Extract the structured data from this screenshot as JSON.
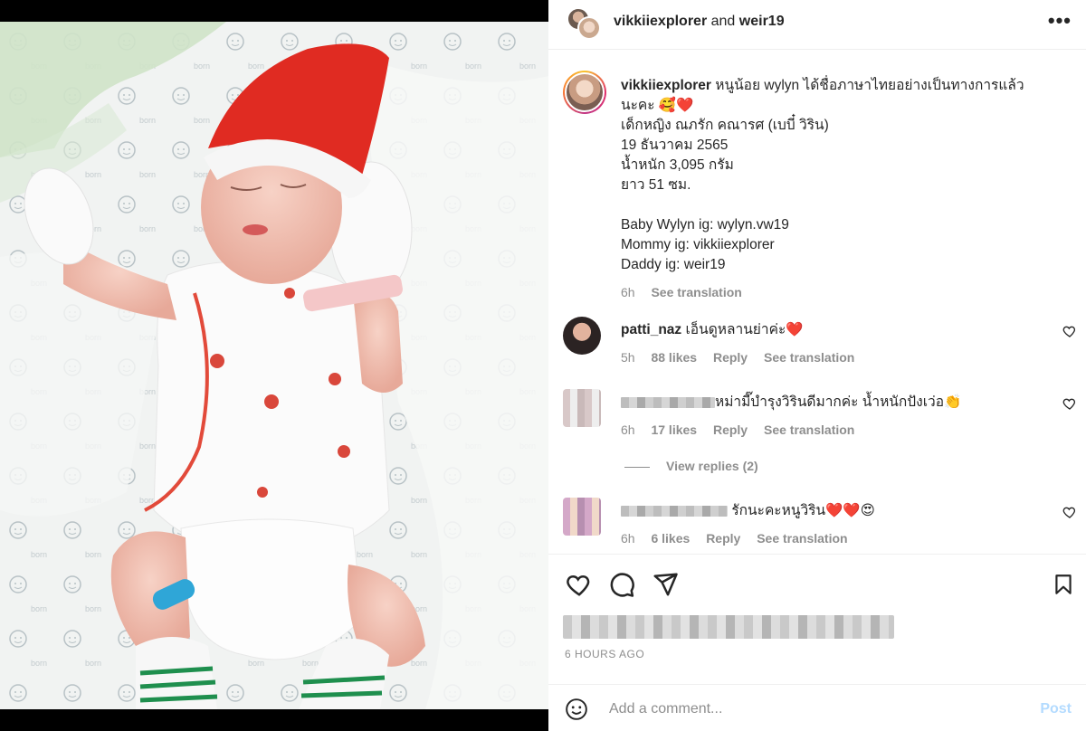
{
  "header": {
    "user1": "vikkiiexplorer",
    "and": "and",
    "user2": "weir19",
    "more": "•••"
  },
  "caption": {
    "username": "vikkiiexplorer",
    "line1": "หนูน้อย wylyn ได้ชื่อภาษาไทยอย่างเป็นทางการแล้ว",
    "line2": "นะคะ 🥰❤️",
    "line3": "เด็กหญิง ณภรัก คณารศ (เบบี๋ วิริน)",
    "line4": "19 ธันวาคม 2565",
    "line5": "น้ำหนัก 3,095 กรัม",
    "line6": "ยาว 51 ซม.",
    "line7": "Baby Wylyn ig: wylyn.vw19",
    "line8": "Mommy ig: vikkiiexplorer",
    "line9": "Daddy ig: weir19",
    "time": "6h",
    "translate": "See translation"
  },
  "comments": [
    {
      "username": "patti_naz",
      "text": "เอ็นดูหลานย่าค่ะ❤️",
      "time": "5h",
      "likes": "88 likes",
      "reply": "Reply",
      "translate": "See translation"
    },
    {
      "username": "",
      "text": "หม่ามี๊บำรุงวิรินดีมากค่ะ น้ำหนักปังเว่อ👏",
      "time": "6h",
      "likes": "17 likes",
      "reply": "Reply",
      "translate": "See translation"
    },
    {
      "username": "",
      "text": "รักนะคะหนูวิริน❤️❤️😍",
      "time": "6h",
      "likes": "6 likes",
      "reply": "Reply",
      "translate": "See translation"
    }
  ],
  "view_replies": "View replies (2)",
  "actions": {
    "like_icon": "heart-icon",
    "comment_icon": "comment-icon",
    "share_icon": "send-icon",
    "save_icon": "bookmark-icon"
  },
  "time_ago": "6 HOURS AGO",
  "add_comment": {
    "placeholder": "Add a comment...",
    "post": "Post",
    "emoji_icon": "smiley-icon"
  }
}
